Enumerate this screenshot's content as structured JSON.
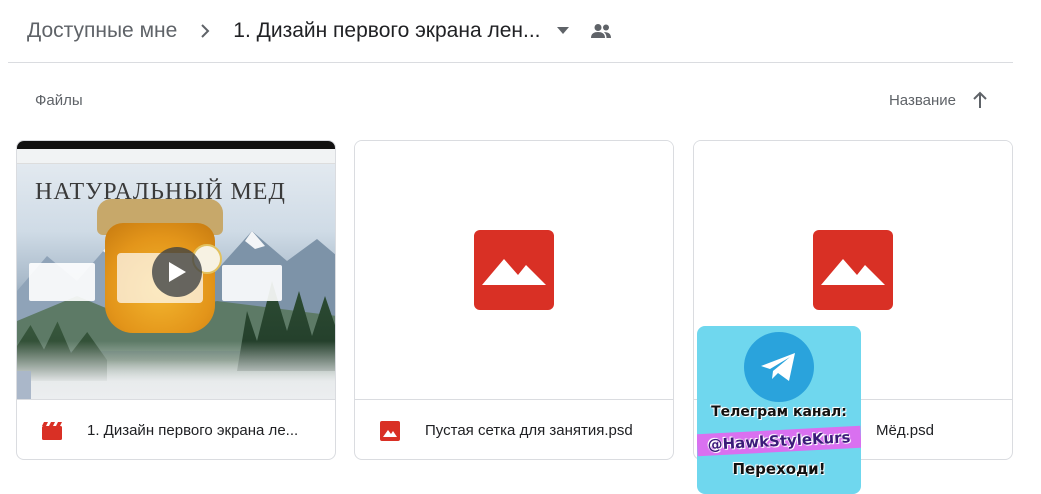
{
  "breadcrumb": {
    "root_label": "Доступные мне",
    "current_label": "1. Дизайн первого экрана лен..."
  },
  "section": {
    "files_label": "Файлы",
    "sort_label": "Название"
  },
  "files": [
    {
      "name": "1. Дизайн первого экрана ле...",
      "type_icon": "video-icon",
      "preview": "video"
    },
    {
      "name": "Пустая сетка для занятия.psd",
      "type_icon": "image-icon",
      "preview": "image-placeholder"
    },
    {
      "name": "Мёд.psd",
      "type_icon": "image-icon",
      "preview": "image-placeholder"
    }
  ],
  "video_preview": {
    "title": "НАТУРАЛЬНЫЙ МЕД"
  },
  "telegram_overlay": {
    "line1": "Телеграм канал:",
    "line2": "@HawkStyleKurs",
    "line3": "Переходи!"
  },
  "colors": {
    "accent_red": "#d93025",
    "border": "#dadce0",
    "text_secondary": "#5f6368",
    "telegram_blue": "#2aa3dc",
    "overlay_bg": "#6fd7ee"
  }
}
